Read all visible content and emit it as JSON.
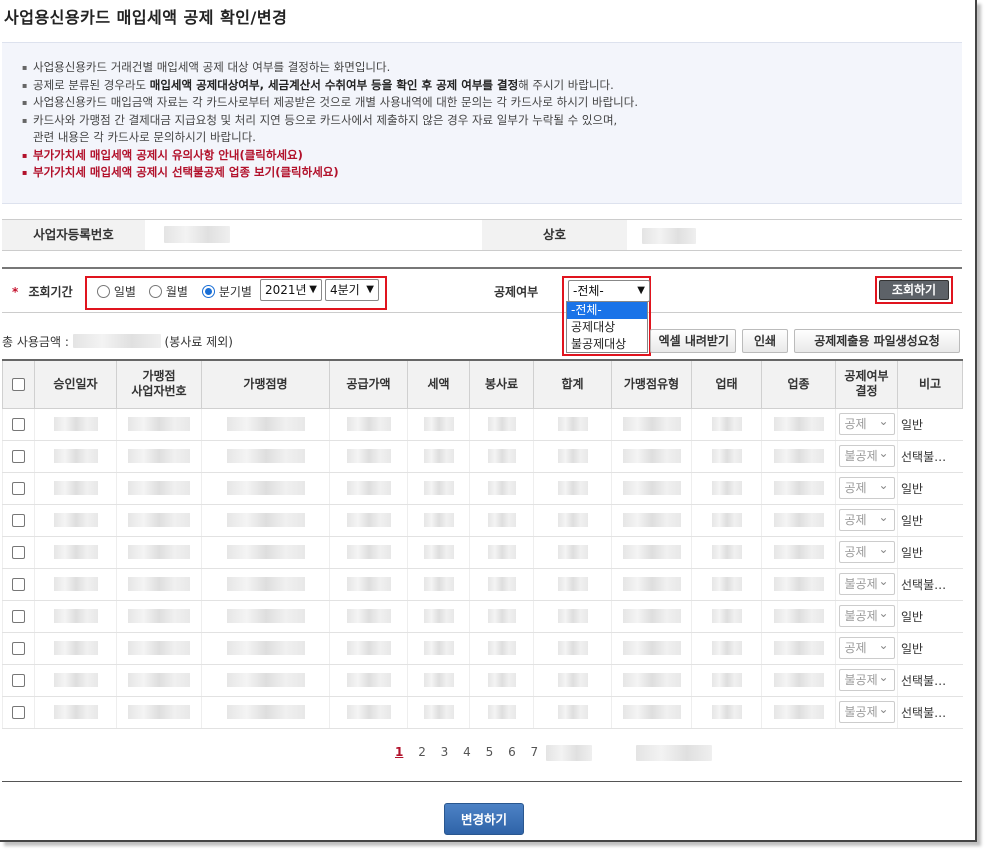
{
  "title": "사업용신용카드 매입세액 공제 확인/변경",
  "info": {
    "lines": [
      "사업용신용카드 거래건별 매입세액 공제 대상 여부를 결정하는 화면입니다.",
      "사업용신용카드 매입금액 자료는 각 카드사로부터 제공받은 것으로 개별 사용내역에 대한 문의는 각 카드사로 하시기 바랍니다.",
      "카드사와 가맹점 간 결제대금 지급요청 및 처리 지연 등으로 카드사에서 제출하지 않은 경우 자료 일부가 누락될 수 있으며,",
      "관련 내용은 각 카드사로 문의하시기 바랍니다."
    ],
    "line2_pre": "공제로 분류된 경우라도 ",
    "line2_bold": "매입세액 공제대상여부, 세금계산서 수취여부 등을 확인 후 공제 여부를 결정",
    "line2_post": "해 주시기 바랍니다.",
    "link1": "부가가치세 매입세액 공제시 유의사항 안내(클릭하세요)",
    "link2": "부가가치세 매입세액 공제시 선택불공제 업종 보기(클릭하세요)"
  },
  "registration": {
    "bizno_label": "사업자등록번호",
    "name_label": "상호"
  },
  "search": {
    "period_label": "조회기간",
    "required_mark": "*",
    "radio_daily": "일별",
    "radio_monthly": "월별",
    "radio_quarterly": "분기별",
    "selected_radio": "분기별",
    "year": "2021년",
    "quarter": "4분기",
    "deduction_label": "공제여부",
    "deduction_value": "-전체-",
    "search_button": "조회하기"
  },
  "dropdown_options": [
    "-전체-",
    "공제대상",
    "불공제대상"
  ],
  "summary": {
    "total_prefix": "총 사용금액 :",
    "total_suffix": "(봉사료 제외)"
  },
  "actions": {
    "excel": "엑셀 내려받기",
    "print": "인쇄",
    "file_request": "공제제출용 파일생성요청"
  },
  "table": {
    "headers": [
      "승인일자",
      "가맹점\n사업자번호",
      "가맹점명",
      "공급가액",
      "세액",
      "봉사료",
      "합계",
      "가맹점유형",
      "업태",
      "업종",
      "공제여부\n결정",
      "비고"
    ],
    "rows": [
      {
        "deduct": "공제",
        "note": "일반"
      },
      {
        "deduct": "불공제",
        "note": "선택불…"
      },
      {
        "deduct": "공제",
        "note": "일반"
      },
      {
        "deduct": "공제",
        "note": "일반"
      },
      {
        "deduct": "공제",
        "note": "일반"
      },
      {
        "deduct": "불공제",
        "note": "선택불…"
      },
      {
        "deduct": "불공제",
        "note": "일반"
      },
      {
        "deduct": "공제",
        "note": "일반"
      },
      {
        "deduct": "불공제",
        "note": "선택불…"
      },
      {
        "deduct": "불공제",
        "note": "선택불…"
      }
    ]
  },
  "pagination": {
    "pages": [
      "1",
      "2",
      "3",
      "4",
      "5",
      "6",
      "7"
    ],
    "current": "1"
  },
  "change_button": "변경하기",
  "colors": {
    "accent_red": "#b2112b",
    "highlight_box": "#e0141e",
    "primary_blue": "#2f63a8",
    "dark_button": "#5d6268"
  }
}
